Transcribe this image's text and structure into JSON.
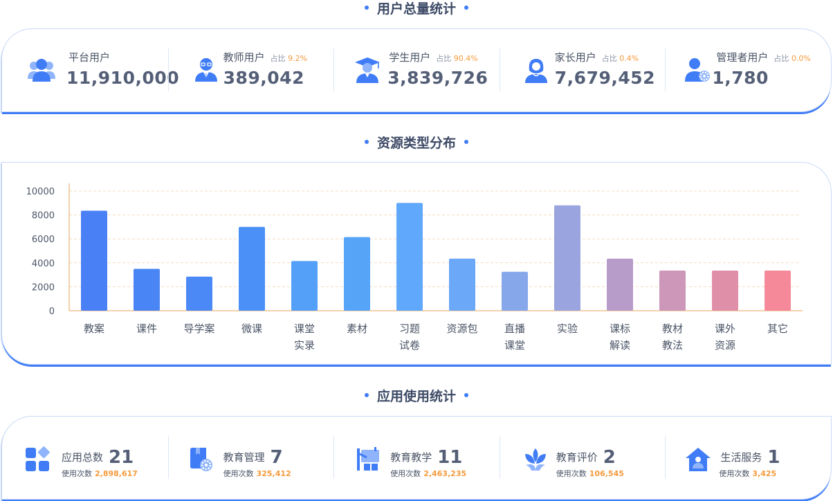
{
  "colors": {
    "accent": "#3f7cf6",
    "percent": "#f59a3b",
    "text": "#4a5466",
    "value": "#545f77"
  },
  "user_section": {
    "title": "用户总量统计",
    "stats": [
      {
        "icon": "users-group-icon",
        "label": "平台用户",
        "value": "11,910,000"
      },
      {
        "icon": "teacher-icon",
        "label": "教师用户",
        "pct_label": "占比",
        "pct": "9.2%",
        "value": "389,042"
      },
      {
        "icon": "student-graduate-icon",
        "label": "学生用户",
        "pct_label": "占比",
        "pct": "90.4%",
        "value": "3,839,726"
      },
      {
        "icon": "parent-icon",
        "label": "家长用户",
        "pct_label": "占比",
        "pct": "0.4%",
        "value": "7,679,452"
      },
      {
        "icon": "admin-gear-icon",
        "label": "管理者用户",
        "pct_label": "占比",
        "pct": "0.0%",
        "value": "1,780"
      }
    ]
  },
  "resource_section": {
    "title": "资源类型分布"
  },
  "chart_data": {
    "type": "bar",
    "categories": [
      "教案",
      "课件",
      "导学案",
      "微课",
      "课堂\n实录",
      "素材",
      "习题\n试卷",
      "资源包",
      "直播\n课堂",
      "实验",
      "课标\n解读",
      "教材\n教法",
      "课外\n资源",
      "其它"
    ],
    "values": [
      8350,
      3500,
      2850,
      7000,
      4150,
      6150,
      9000,
      4350,
      3250,
      8800,
      4350,
      3350,
      3350,
      3350
    ],
    "colors": [
      "#4a80f6",
      "#4a85f6",
      "#4b89f6",
      "#4b90f6",
      "#54a0f8",
      "#55a4f8",
      "#5fa8fb",
      "#6ba8f8",
      "#86a7ea",
      "#9aa4de",
      "#b79bc8",
      "#cc97b9",
      "#e08fa9",
      "#f5899a"
    ],
    "yticks": [
      0,
      2000,
      4000,
      6000,
      8000,
      10000
    ],
    "ylim": [
      0,
      10000
    ],
    "grid": true
  },
  "app_section": {
    "title": "应用使用统计",
    "usage_label": "使用次数",
    "apps": [
      {
        "icon": "app-grid-icon",
        "label": "应用总数",
        "count": "21",
        "usage": "2,898,617"
      },
      {
        "icon": "management-gear-icon",
        "label": "教育管理",
        "count": "7",
        "usage": "325,412"
      },
      {
        "icon": "teaching-board-icon",
        "label": "教育教学",
        "count": "11",
        "usage": "2,463,235"
      },
      {
        "icon": "evaluation-flower-icon",
        "label": "教育评价",
        "count": "2",
        "usage": "106,545"
      },
      {
        "icon": "home-service-icon",
        "label": "生活服务",
        "count": "1",
        "usage": "3,425"
      }
    ]
  }
}
